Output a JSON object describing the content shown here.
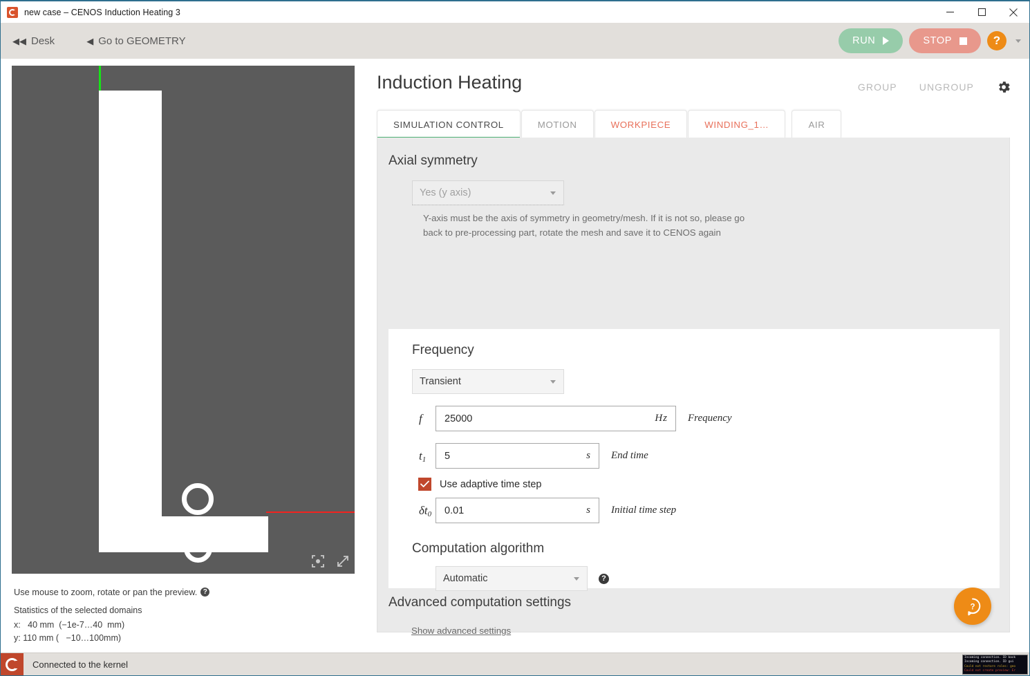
{
  "window": {
    "title": "new case – CENOS Induction Heating 3",
    "app_icon": "cenos-logo-icon",
    "minimize_label": "minimize-icon",
    "maximize_label": "maximize-icon",
    "close_label": "close-icon"
  },
  "toolbar": {
    "desk_label": "Desk",
    "desk_arrow": "◀◀",
    "geometry_label": "Go to GEOMETRY",
    "geometry_arrow": "◀",
    "run_label": "RUN",
    "stop_label": "STOP",
    "help_label": "?"
  },
  "preview": {
    "caption": "Use mouse to zoom, rotate or pan the preview.",
    "caption_help": "?",
    "stats_title": "Statistics of the selected domains",
    "stats_x": "x:   40 mm  (−1e-7…40  mm)",
    "stats_y": "y: 110 mm (   −10…100mm)",
    "background_color": "#5b5b5b",
    "axis_color": "#18e218",
    "highlight_color": "#f2231f",
    "tool_reset": "reset-camera-icon",
    "tool_expand": "expand-icon"
  },
  "header": {
    "title": "Induction Heating",
    "group_label": "GROUP",
    "ungroup_label": "UNGROUP",
    "settings_icon": "gear-icon"
  },
  "tabs": [
    {
      "label": "SIMULATION CONTROL",
      "state": "active"
    },
    {
      "label": "MOTION",
      "state": "inactive"
    },
    {
      "label": "WORKPIECE",
      "state": "red"
    },
    {
      "label": "WINDING_1…",
      "state": "red"
    },
    {
      "label": "AIR",
      "state": "inactive"
    }
  ],
  "axial": {
    "heading": "Axial symmetry",
    "select_value": "Yes (y axis)",
    "hint_line1": "Y-axis must be the axis of symmetry in geometry/mesh. If it is not so, please go",
    "hint_line2": "back to pre-processing part, rotate the mesh and save it to CENOS again"
  },
  "frequency": {
    "heading": "Frequency",
    "mode_value": "Transient",
    "fields": [
      {
        "symbol": "f",
        "sub": "",
        "value": "25000",
        "unit": "Hz",
        "description": "Frequency"
      },
      {
        "symbol": "t",
        "sub": "1",
        "value": "5",
        "unit": "s",
        "description": "End time"
      },
      {
        "symbol": "δt",
        "sub": "0",
        "value": "0.01",
        "unit": "s",
        "description": "Initial time step"
      }
    ],
    "checkbox_label": "Use adaptive time step",
    "checkbox_checked": true,
    "checkbox_color": "#c0472c"
  },
  "algorithm": {
    "heading": "Computation algorithm",
    "select_value": "Automatic",
    "help_icon": "question-mark-icon"
  },
  "advanced": {
    "heading": "Advanced computation settings",
    "link_label": "Show advanced settings"
  },
  "fab": {
    "icon": "help-bubble-icon"
  },
  "statusbar": {
    "icon": "cenos-logo-icon",
    "text": "Connected to the kernel",
    "terminal": [
      {
        "text": "Incoming connection. ID back",
        "color": "white"
      },
      {
        "text": "Incoming connection. ID gui ",
        "color": "white"
      },
      {
        "text": "Could not restore roles: geo",
        "color": "yellow"
      },
      {
        "text": "Could not create preview: Er",
        "color": "red"
      }
    ]
  },
  "colors": {
    "accent_green": "#4caf72",
    "accent_red": "#e8705a",
    "brand_orange": "#ee8b16",
    "brand_red": "#c0472c",
    "toolbar_bg": "#e2dfdb",
    "panel_bg": "#eaeaea"
  }
}
